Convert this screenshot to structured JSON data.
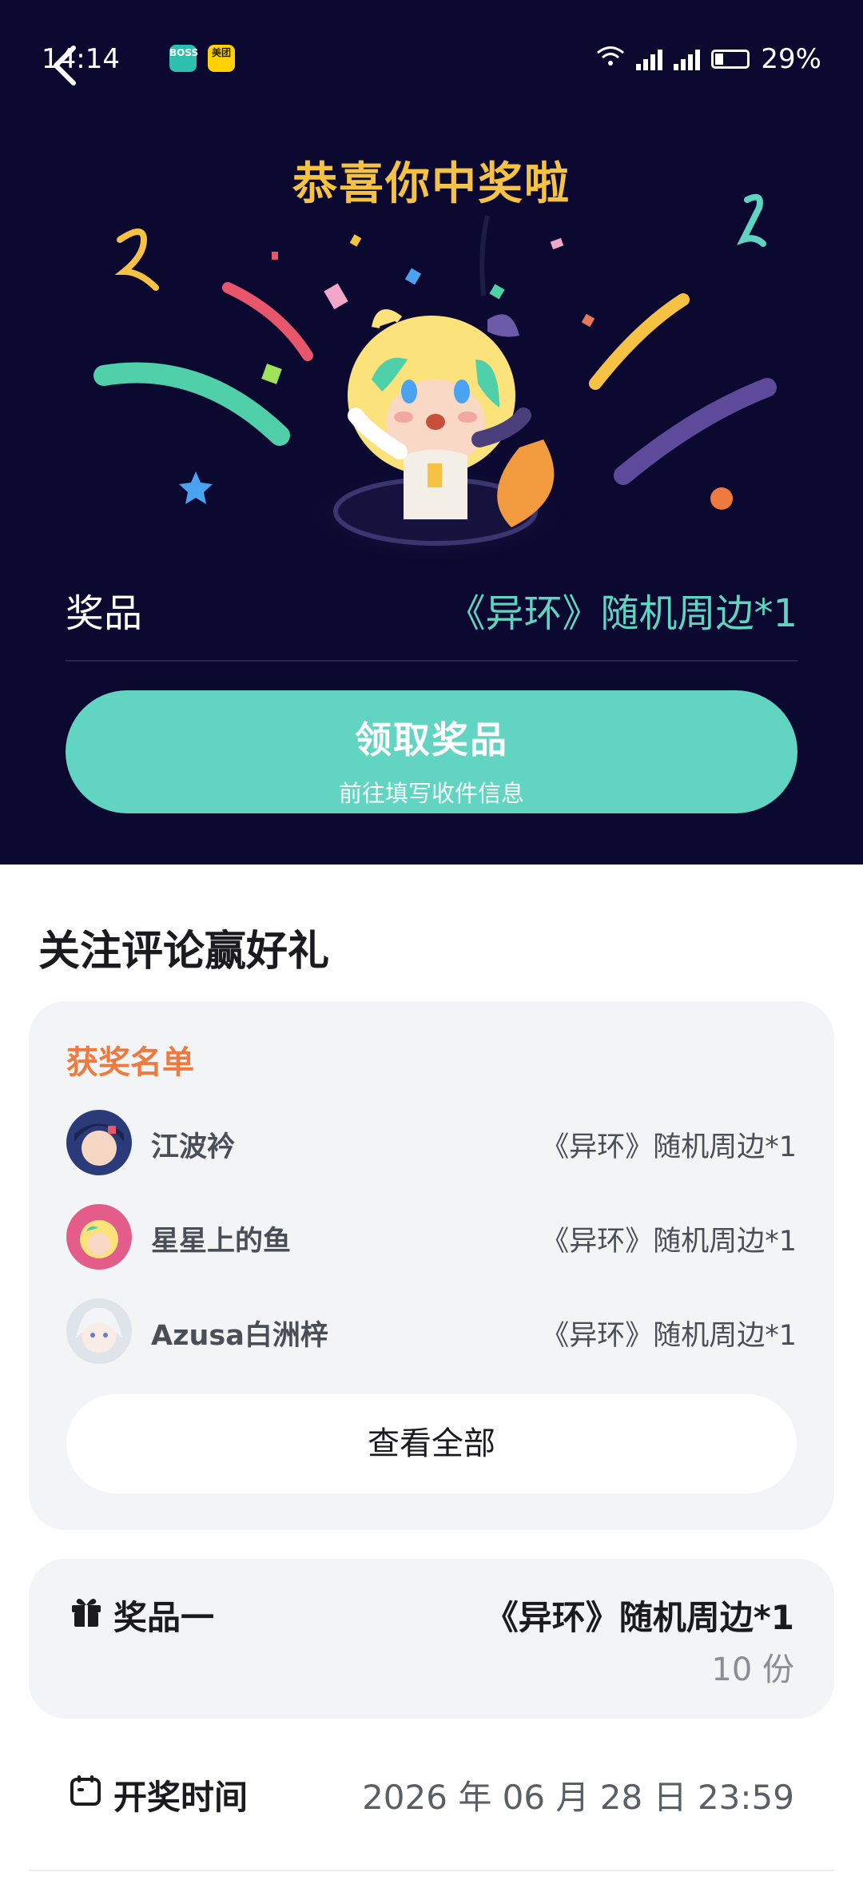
{
  "status_bar": {
    "time": "14:14",
    "battery": "29%",
    "app_badges": [
      "BOSS直聘",
      "美团"
    ]
  },
  "hero": {
    "title": "恭喜你中奖啦",
    "prize_label": "奖品",
    "prize_value": "《异环》随机周边*1",
    "claim_button": {
      "label": "领取奖品",
      "sub": "前往填写收件信息"
    }
  },
  "section": {
    "title": "关注评论赢好礼"
  },
  "winners": {
    "heading": "获奖名单",
    "items": [
      {
        "name": "江波衿",
        "award": "《异环》随机周边*1"
      },
      {
        "name": "星星上的鱼",
        "award": "《异环》随机周边*1"
      },
      {
        "name": "Azusa白洲梓",
        "award": "《异环》随机周边*1"
      }
    ],
    "view_all": "查看全部"
  },
  "prize_one": {
    "label": "奖品一",
    "value": "《异环》随机周边*1",
    "count": "10 份"
  },
  "draw_time": {
    "label": "开奖时间",
    "value": "2026 年 06 月 28 日 23:59"
  },
  "colors": {
    "hero_bg": "#0b0930",
    "accent_teal": "#62d4c2",
    "title_gold": "#f6c244",
    "winner_head": "#ee7a3f"
  }
}
